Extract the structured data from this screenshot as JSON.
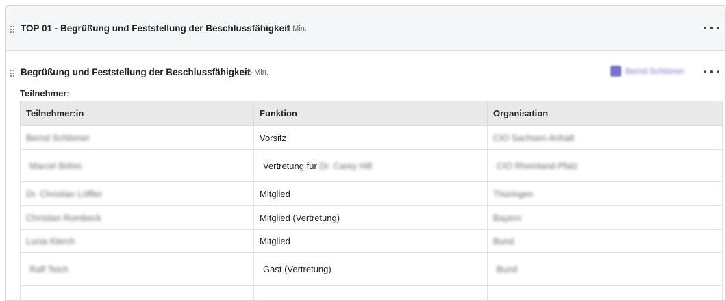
{
  "agenda_item": {
    "title": "TOP 01 - Begrüßung und Feststellung der Beschlussfähigkeit",
    "duration": "5 Min."
  },
  "topic": {
    "title": "Begrüßung und Feststellung der Beschlussfähigkeit",
    "duration": "5 Min.",
    "presenter": "Bernd Schlömer"
  },
  "participants": {
    "label": "Teilnehmer:",
    "columns": [
      "Teilnehmer:in",
      "Funktion",
      "Organisation"
    ],
    "rows": [
      {
        "name": "Bernd Schlömer",
        "function": "Vorsitz",
        "function_extra": "",
        "org": "CIO Sachsen-Anhalt"
      },
      {
        "name": "Marcel Böhm",
        "function": "Vertretung für ",
        "function_extra": "Dr. Carey Hill",
        "org": "CIO Rheinland-Pfalz"
      },
      {
        "name": "Dr. Christian Löffler",
        "function": "Mitglied",
        "function_extra": "",
        "org": "Thüringen"
      },
      {
        "name": "Christian Rombeck",
        "function": "Mitglied (Vertretung)",
        "function_extra": "",
        "org": "Bayern"
      },
      {
        "name": "Lucia Klerch",
        "function": "Mitglied",
        "function_extra": "",
        "org": "Bund"
      },
      {
        "name": "Ralf Teich",
        "function": "Gast (Vertretung)",
        "function_extra": "",
        "org": "Bund"
      }
    ]
  }
}
